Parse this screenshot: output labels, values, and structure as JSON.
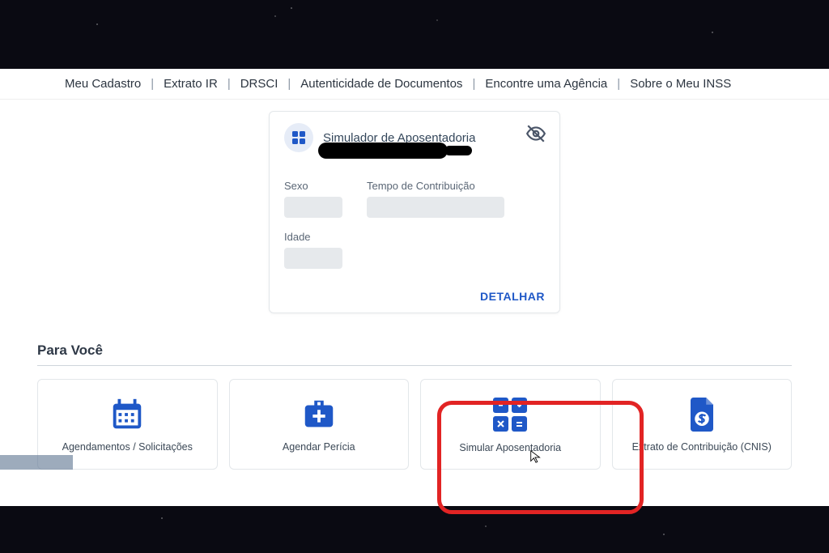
{
  "topnav": {
    "items": [
      "Meu Cadastro",
      "Extrato IR",
      "DRSCI",
      "Autenticidade de Documentos",
      "Encontre uma Agência",
      "Sobre o Meu INSS"
    ]
  },
  "card": {
    "title": "Simulador de Aposentadoria",
    "fields": {
      "sexo_label": "Sexo",
      "tempo_label": "Tempo de Contribuição",
      "idade_label": "Idade"
    },
    "action": "DETALHAR"
  },
  "section": {
    "title": "Para Você"
  },
  "tiles": [
    {
      "label": "Agendamentos / Solicitações"
    },
    {
      "label": "Agendar Perícia"
    },
    {
      "label": "Simular Aposentadoria"
    },
    {
      "label": "Extrato de Contribuição (CNIS)"
    }
  ]
}
